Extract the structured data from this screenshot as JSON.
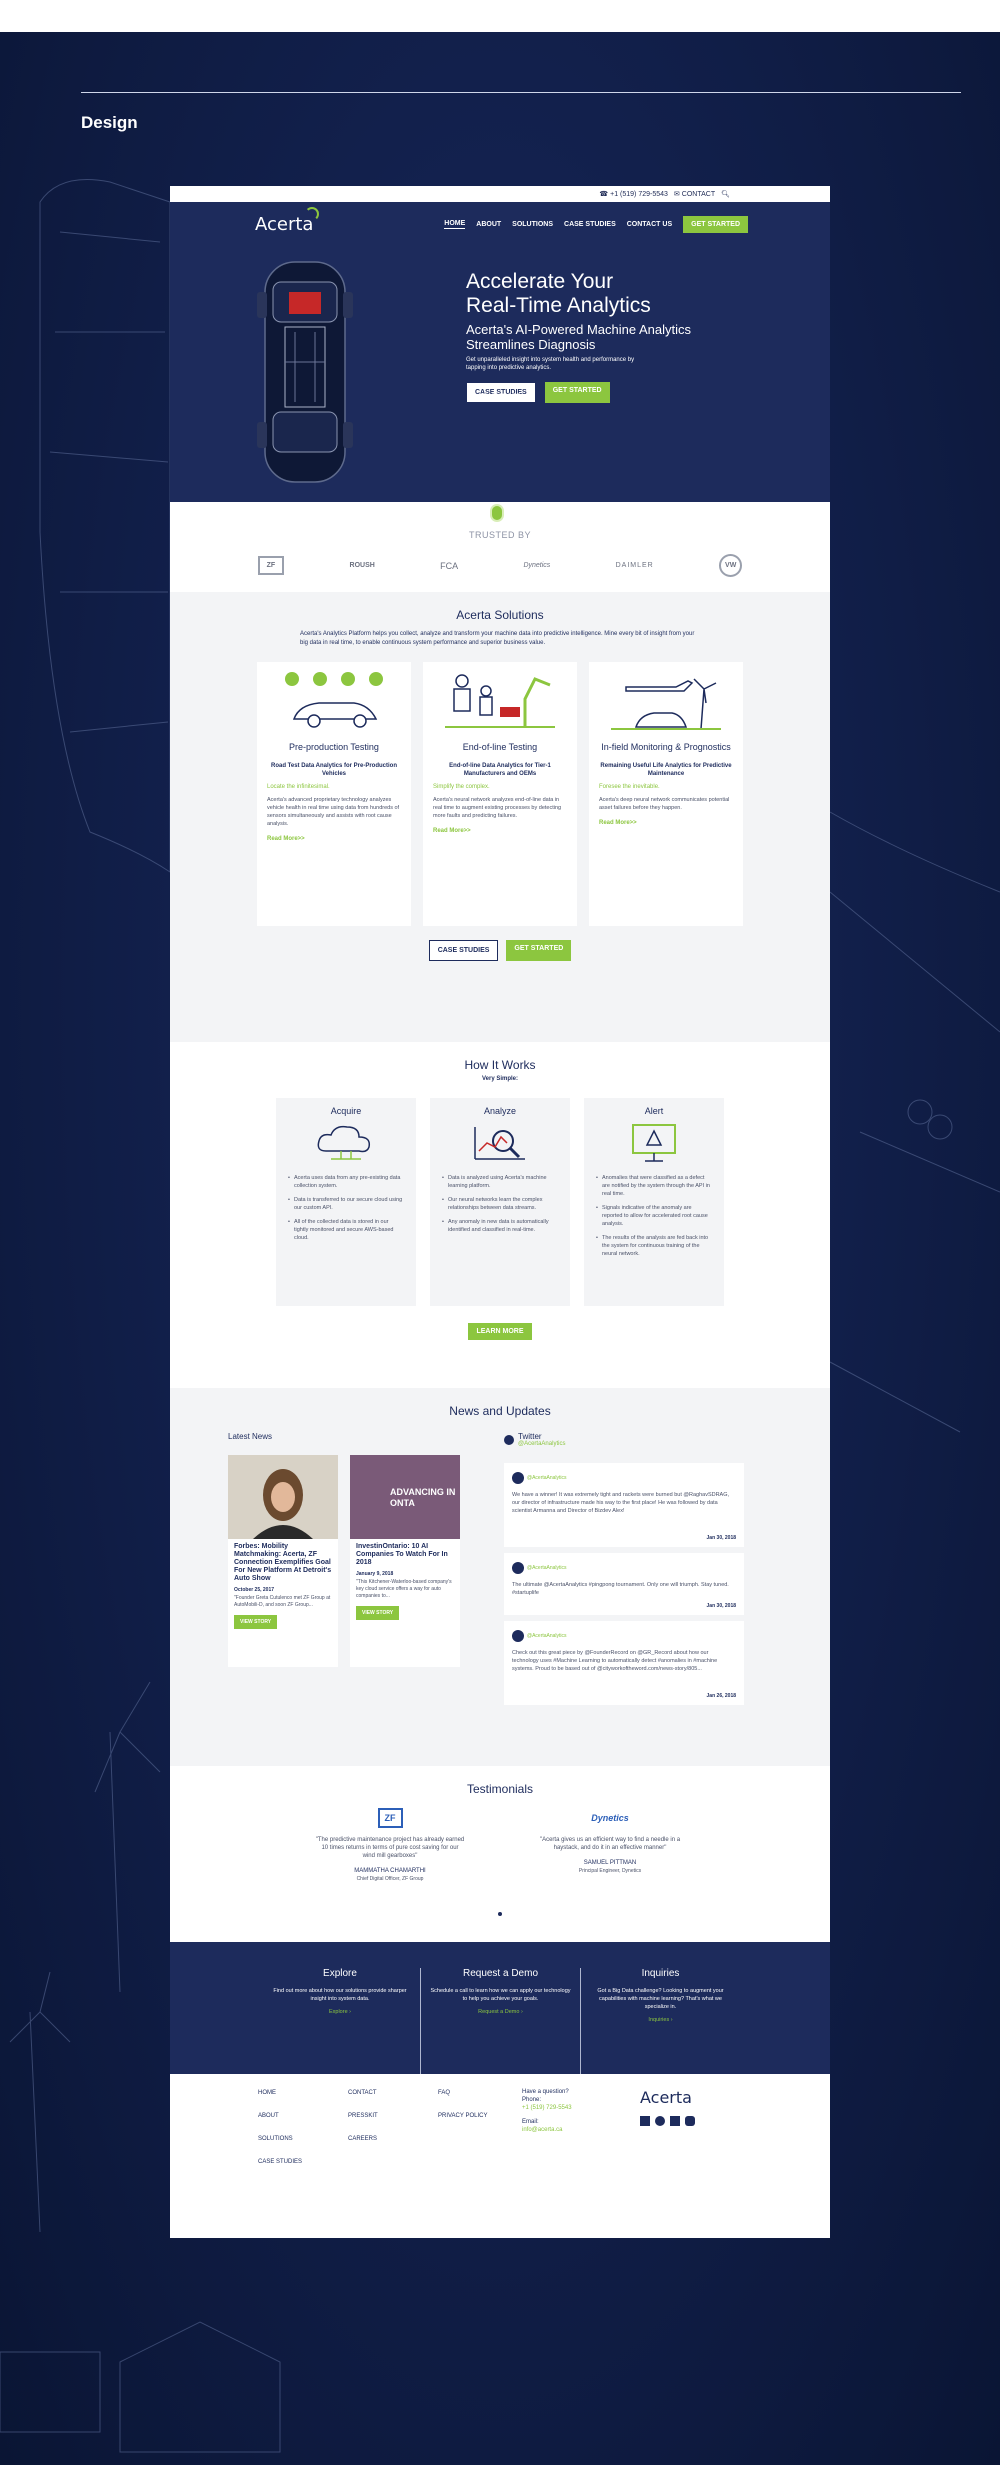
{
  "design_label": "Design",
  "util": {
    "phone": "+1 (519) 729-5543",
    "contact": "CONTACT"
  },
  "hero": {
    "logo": "Acerta",
    "nav": [
      "HOME",
      "ABOUT",
      "SOLUTIONS",
      "CASE STUDIES",
      "CONTACT US"
    ],
    "nav_cta": "GET STARTED",
    "title_line1": "Accelerate Your",
    "title_line2": "Real-Time Analytics",
    "subtitle_line1": "Acerta's AI-Powered Machine Analytics",
    "subtitle_line2": "Streamlines Diagnosis",
    "desc": "Get unparalleled insight into system health and performance by tapping into predictive analytics.",
    "btn_case": "CASE STUDIES",
    "btn_start": "GET STARTED",
    "learn_more": "LEARN MORE"
  },
  "trusted": {
    "title": "TRUSTED BY",
    "logos": [
      "ZF",
      "ROUSH",
      "FCA",
      "Dynetics",
      "DAIMLER",
      "VW"
    ]
  },
  "solutions": {
    "title": "Acerta Solutions",
    "intro": "Acerta's Analytics Platform helps you collect, analyze and transform your machine data into predictive intelligence. Mine every bit of insight from your big data in real time, to enable continuous system performance and superior business value.",
    "cards": [
      {
        "title": "Pre-production Testing",
        "sub": "Road Test Data Analytics for Pre-Production Vehicles",
        "tag": "Locate the infinitesimal.",
        "body": "Acerta's advanced proprietary technology analyzes vehicle health in real time using data from hundreds of sensors simultaneously and assists with root cause analysis.",
        "more": "Read More>>"
      },
      {
        "title": "End-of-line Testing",
        "sub": "End-of-line Data Analytics for Tier-1 Manufacturers and OEMs",
        "tag": "Simplify the complex.",
        "body": "Acerta's neural network analyzes end-of-line data in real time to augment existing processes by detecting more faults and predicting failures.",
        "more": "Read More>>"
      },
      {
        "title": "In-field Monitoring & Prognostics",
        "sub": "Remaining Useful Life Analytics for Predictive Maintenance",
        "tag": "Foresee the inevitable.",
        "body": "Acerta's deep neural network communicates potential asset failures before they happen.",
        "more": "Read More>>"
      }
    ],
    "btn_case": "CASE STUDIES",
    "btn_start": "GET STARTED"
  },
  "how": {
    "title": "How It Works",
    "sub": "Very Simple:",
    "cards": [
      {
        "title": "Acquire",
        "items": [
          "Acerta uses data from any pre-existing data collection system.",
          "Data is transferred to our secure cloud using our custom API.",
          "All of the collected data is stored in our tightly monitored and secure AWS-based cloud."
        ]
      },
      {
        "title": "Analyze",
        "items": [
          "Data is analyzed using Acerta's machine learning platform.",
          "Our neural networks learn the complex relationships between data streams.",
          "Any anomaly in new data is automatically identified and classified in real-time."
        ]
      },
      {
        "title": "Alert",
        "items": [
          "Anomalies that were classified as a defect are notified by the system through the API in real time.",
          "Signals indicative of the anomaly are reported to allow for accelerated root cause analysis.",
          "The results of the analysis are fed back into the system for continuous training of the neural network."
        ]
      }
    ],
    "btn": "LEARN MORE"
  },
  "news": {
    "title": "News and Updates",
    "latest_label": "Latest News",
    "articles": [
      {
        "title": "Forbes: Mobility Matchmaking: Acerta, ZF Connection Exemplifies Goal For New Platform At Detroit's Auto Show",
        "date": "October 25, 2017",
        "excerpt": "\"Founder Greta Cutulenco met ZF Group at AutoMobili-D, and soon ZF Group...",
        "btn": "VIEW STORY",
        "img_text": ""
      },
      {
        "title": "InvestinOntario: 10 AI Companies To Watch For In 2018",
        "date": "January 9, 2018",
        "excerpt": "\"This Kitchener-Waterloo-based company's key cloud service offers a way for auto companies to...",
        "btn": "VIEW STORY",
        "img_text": "ADVANCING IN ONTA"
      }
    ],
    "twitter_name": "Twitter",
    "twitter_handle": "@AcertaAnalytics",
    "tweets": [
      {
        "handle": "@AcertaAnalytics",
        "text": "We have a winner! It was extremely tight and rackets were burned but @RaghavSDRAG, our director of infrastructure made his way to the first place! He was followed by data scientist Armanna and Director of Bizdev Alex!",
        "date": "Jan 30, 2018"
      },
      {
        "handle": "@AcertaAnalytics",
        "text": "The ultimate @AcertaAnalytics #pingpong tournament. Only one will triumph. Stay tuned. #startuplife",
        "date": "Jan 30, 2018"
      },
      {
        "handle": "@AcertaAnalytics",
        "text": "Check out this great piece by @FounderRecord on @GR_Record about how our technology uses #Machine Learning to automatically detect #anomalies in #machine systems. Proud to be based out of @cityworkoftheword.com/news-story/805...",
        "date": "Jan 26, 2018"
      }
    ]
  },
  "testimonials": {
    "title": "Testimonials",
    "items": [
      {
        "logo": "ZF",
        "quote": "\"The predictive maintenance project has already earned 10 times returns in terms of pure cost saving for our wind mill gearboxes\"",
        "name": "MAMMATHA CHAMARTHI",
        "role": "Chief Digital Officer, ZF Group"
      },
      {
        "logo": "Dynetics",
        "quote": "\"Acerta gives us an efficient way to find a needle in a haystack, and do it in an effective manner\"",
        "name": "SAMUEL PITTMAN",
        "role": "Principal Engineer, Dynetics"
      }
    ]
  },
  "cta": [
    {
      "title": "Explore",
      "text": "Find out more about how our solutions provide sharper insight into system data.",
      "link": "Explore ›"
    },
    {
      "title": "Request a Demo",
      "text": "Schedule a call to learn how we can apply our technology to help you achieve your goals.",
      "link": "Request a Demo ›"
    },
    {
      "title": "Inquiries",
      "text": "Got a Big Data challenge? Looking to augment your capabilities with machine learning? That's what we specialize in.",
      "link": "Inquiries ›"
    }
  ],
  "footer": {
    "col1": [
      "HOME",
      "ABOUT",
      "SOLUTIONS",
      "CASE STUDIES"
    ],
    "col2": [
      "CONTACT",
      "PRESSKIT",
      "CAREERS"
    ],
    "col3": [
      "FAQ",
      "PRIVACY POLICY"
    ],
    "question": "Have a question?",
    "phone_label": "Phone:",
    "phone": "+1 (519) 729-5543",
    "email_label": "Email:",
    "email": "info@acerta.ca",
    "logo": "Acerta"
  },
  "colors": {
    "navy": "#1d2b5c",
    "green": "#8cc63f",
    "bg": "#12204c"
  }
}
